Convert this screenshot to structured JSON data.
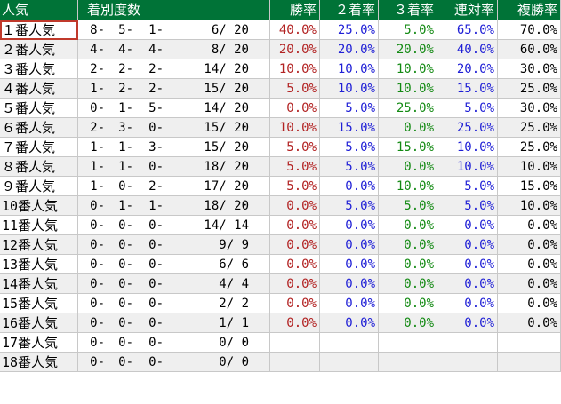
{
  "headers": [
    "人気",
    "着別度数",
    "勝率",
    "２着率",
    "３着率",
    "連対率",
    "複勝率"
  ],
  "colors": {
    "header_bg": "#007337",
    "win_rate": "#b22222",
    "second_rate": "#1f1fd6",
    "third_rate": "#138a13",
    "rentai_rate": "#1f1fd6",
    "fukusho_rate": "#000000",
    "selected_outline": "#c0392b"
  },
  "rows": [
    {
      "label": "１番人気",
      "first": "8-",
      "second": "5-",
      "third": "1-",
      "total": "6/ 20",
      "win": "40.0%",
      "place2": "25.0%",
      "place3": "5.0%",
      "rentai": "65.0%",
      "fukusho": "70.0%"
    },
    {
      "label": "２番人気",
      "first": "4-",
      "second": "4-",
      "third": "4-",
      "total": "8/ 20",
      "win": "20.0%",
      "place2": "20.0%",
      "place3": "20.0%",
      "rentai": "40.0%",
      "fukusho": "60.0%"
    },
    {
      "label": "３番人気",
      "first": "2-",
      "second": "2-",
      "third": "2-",
      "total": "14/ 20",
      "win": "10.0%",
      "place2": "10.0%",
      "place3": "10.0%",
      "rentai": "20.0%",
      "fukusho": "30.0%"
    },
    {
      "label": "４番人気",
      "first": "1-",
      "second": "2-",
      "third": "2-",
      "total": "15/ 20",
      "win": "5.0%",
      "place2": "10.0%",
      "place3": "10.0%",
      "rentai": "15.0%",
      "fukusho": "25.0%"
    },
    {
      "label": "５番人気",
      "first": "0-",
      "second": "1-",
      "third": "5-",
      "total": "14/ 20",
      "win": "0.0%",
      "place2": "5.0%",
      "place3": "25.0%",
      "rentai": "5.0%",
      "fukusho": "30.0%"
    },
    {
      "label": "６番人気",
      "first": "2-",
      "second": "3-",
      "third": "0-",
      "total": "15/ 20",
      "win": "10.0%",
      "place2": "15.0%",
      "place3": "0.0%",
      "rentai": "25.0%",
      "fukusho": "25.0%"
    },
    {
      "label": "７番人気",
      "first": "1-",
      "second": "1-",
      "third": "3-",
      "total": "15/ 20",
      "win": "5.0%",
      "place2": "5.0%",
      "place3": "15.0%",
      "rentai": "10.0%",
      "fukusho": "25.0%"
    },
    {
      "label": "８番人気",
      "first": "1-",
      "second": "1-",
      "third": "0-",
      "total": "18/ 20",
      "win": "5.0%",
      "place2": "5.0%",
      "place3": "0.0%",
      "rentai": "10.0%",
      "fukusho": "10.0%"
    },
    {
      "label": "９番人気",
      "first": "1-",
      "second": "0-",
      "third": "2-",
      "total": "17/ 20",
      "win": "5.0%",
      "place2": "0.0%",
      "place3": "10.0%",
      "rentai": "5.0%",
      "fukusho": "15.0%"
    },
    {
      "label": "10番人気",
      "first": "0-",
      "second": "1-",
      "third": "1-",
      "total": "18/ 20",
      "win": "0.0%",
      "place2": "5.0%",
      "place3": "5.0%",
      "rentai": "5.0%",
      "fukusho": "10.0%"
    },
    {
      "label": "11番人気",
      "first": "0-",
      "second": "0-",
      "third": "0-",
      "total": "14/ 14",
      "win": "0.0%",
      "place2": "0.0%",
      "place3": "0.0%",
      "rentai": "0.0%",
      "fukusho": "0.0%"
    },
    {
      "label": "12番人気",
      "first": "0-",
      "second": "0-",
      "third": "0-",
      "total": "9/ 9",
      "win": "0.0%",
      "place2": "0.0%",
      "place3": "0.0%",
      "rentai": "0.0%",
      "fukusho": "0.0%"
    },
    {
      "label": "13番人気",
      "first": "0-",
      "second": "0-",
      "third": "0-",
      "total": "6/ 6",
      "win": "0.0%",
      "place2": "0.0%",
      "place3": "0.0%",
      "rentai": "0.0%",
      "fukusho": "0.0%"
    },
    {
      "label": "14番人気",
      "first": "0-",
      "second": "0-",
      "third": "0-",
      "total": "4/ 4",
      "win": "0.0%",
      "place2": "0.0%",
      "place3": "0.0%",
      "rentai": "0.0%",
      "fukusho": "0.0%"
    },
    {
      "label": "15番人気",
      "first": "0-",
      "second": "0-",
      "third": "0-",
      "total": "2/ 2",
      "win": "0.0%",
      "place2": "0.0%",
      "place3": "0.0%",
      "rentai": "0.0%",
      "fukusho": "0.0%"
    },
    {
      "label": "16番人気",
      "first": "0-",
      "second": "0-",
      "third": "0-",
      "total": "1/ 1",
      "win": "0.0%",
      "place2": "0.0%",
      "place3": "0.0%",
      "rentai": "0.0%",
      "fukusho": "0.0%"
    },
    {
      "label": "17番人気",
      "first": "0-",
      "second": "0-",
      "third": "0-",
      "total": "0/ 0",
      "win": "",
      "place2": "",
      "place3": "",
      "rentai": "",
      "fukusho": ""
    },
    {
      "label": "18番人気",
      "first": "0-",
      "second": "0-",
      "third": "0-",
      "total": "0/ 0",
      "win": "",
      "place2": "",
      "place3": "",
      "rentai": "",
      "fukusho": ""
    }
  ]
}
